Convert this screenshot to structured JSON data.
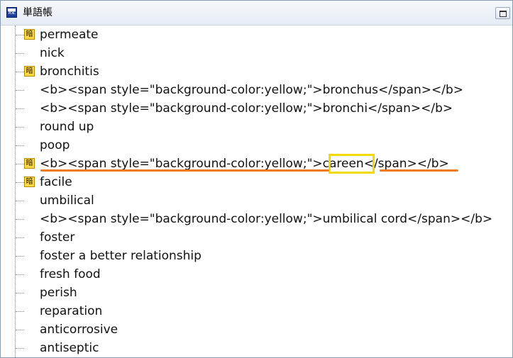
{
  "window": {
    "title": "単語帳",
    "app_icon_text": "PDIC"
  },
  "tree": {
    "items": [
      {
        "label": "permeate",
        "badge": "暗"
      },
      {
        "label": "nick",
        "badge": ""
      },
      {
        "label": "bronchitis",
        "badge": "暗"
      },
      {
        "label": "<b><span style=\"background-color:yellow;\">bronchus</span></b>",
        "badge": ""
      },
      {
        "label": "<b><span style=\"background-color:yellow;\">bronchi</span></b>",
        "badge": ""
      },
      {
        "label": "round up",
        "badge": ""
      },
      {
        "label": "poop",
        "badge": ""
      },
      {
        "label": "<b><span style=\"background-color:yellow;\">careen</span></b>",
        "badge": "暗"
      },
      {
        "label": "facile",
        "badge": "暗"
      },
      {
        "label": "umbilical",
        "badge": ""
      },
      {
        "label": "<b><span style=\"background-color:yellow;\">umbilical cord</span></b>",
        "badge": ""
      },
      {
        "label": "foster",
        "badge": ""
      },
      {
        "label": "foster a better relationship",
        "badge": ""
      },
      {
        "label": "fresh food",
        "badge": ""
      },
      {
        "label": "perish",
        "badge": ""
      },
      {
        "label": "reparation",
        "badge": ""
      },
      {
        "label": "anticorrosive",
        "badge": ""
      },
      {
        "label": "antiseptic",
        "badge": ""
      }
    ]
  },
  "annotations": {
    "highlight_box_color": "#f2dc00",
    "underline_color": "#f07a1e"
  }
}
